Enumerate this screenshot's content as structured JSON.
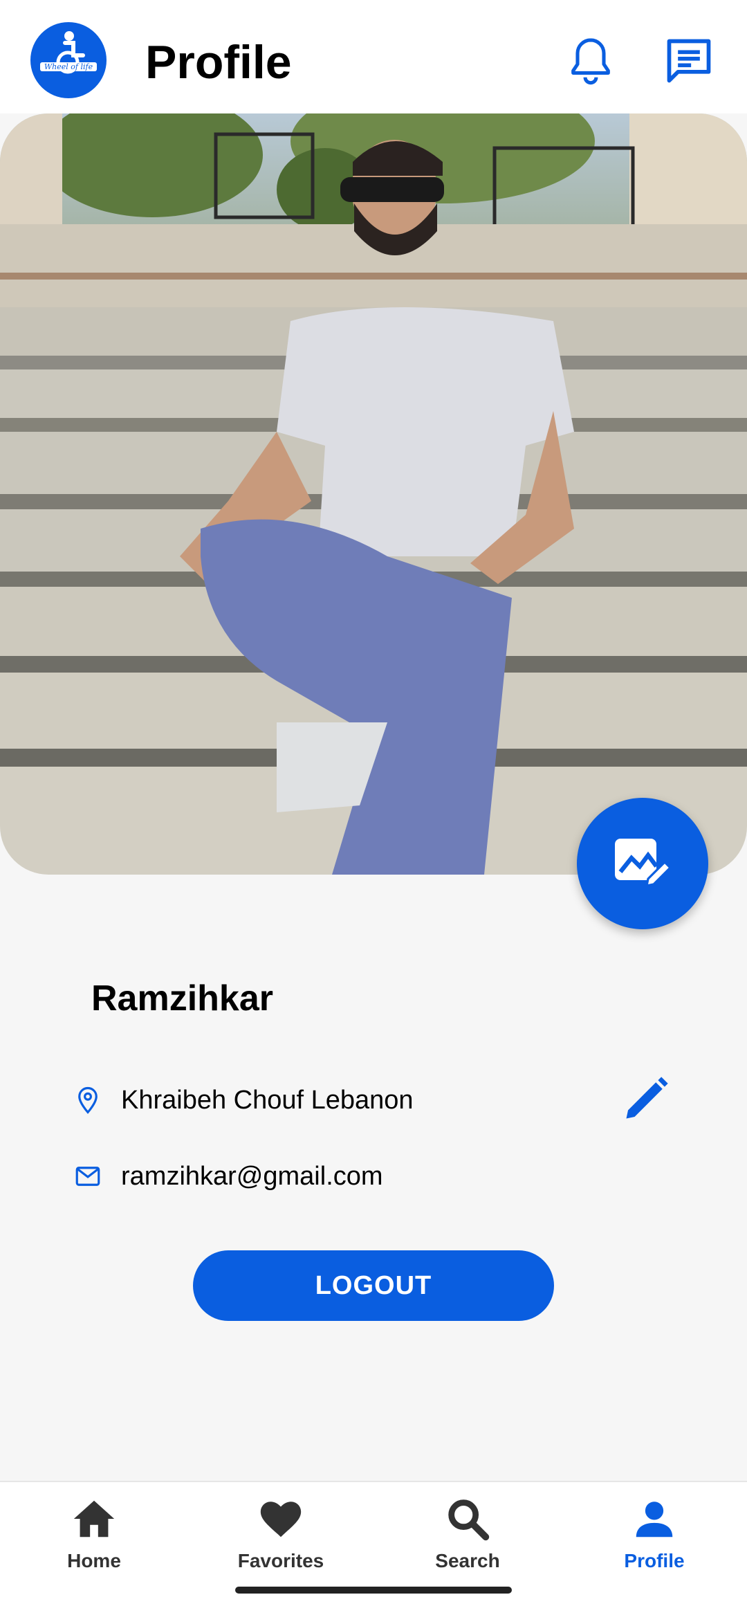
{
  "header": {
    "title": "Profile",
    "logo_text": "Wheel of life",
    "logo_icon": "wheelchair-icon",
    "notifications_icon": "bell-icon",
    "messages_icon": "chat-icon"
  },
  "profile": {
    "photo_icon": "edit-photo-icon",
    "name": "Ramzihkar",
    "location": "Khraibeh Chouf Lebanon",
    "email": "ramzihkar@gmail.com",
    "logout_label": "LOGOUT"
  },
  "nav": {
    "items": [
      {
        "label": "Home",
        "icon": "home-icon",
        "active": false
      },
      {
        "label": "Favorites",
        "icon": "heart-icon",
        "active": false
      },
      {
        "label": "Search",
        "icon": "search-icon",
        "active": false
      },
      {
        "label": "Profile",
        "icon": "person-icon",
        "active": true
      }
    ]
  },
  "colors": {
    "accent": "#0a5ee0",
    "background": "#f6f6f6",
    "nav_inactive": "#333333"
  }
}
